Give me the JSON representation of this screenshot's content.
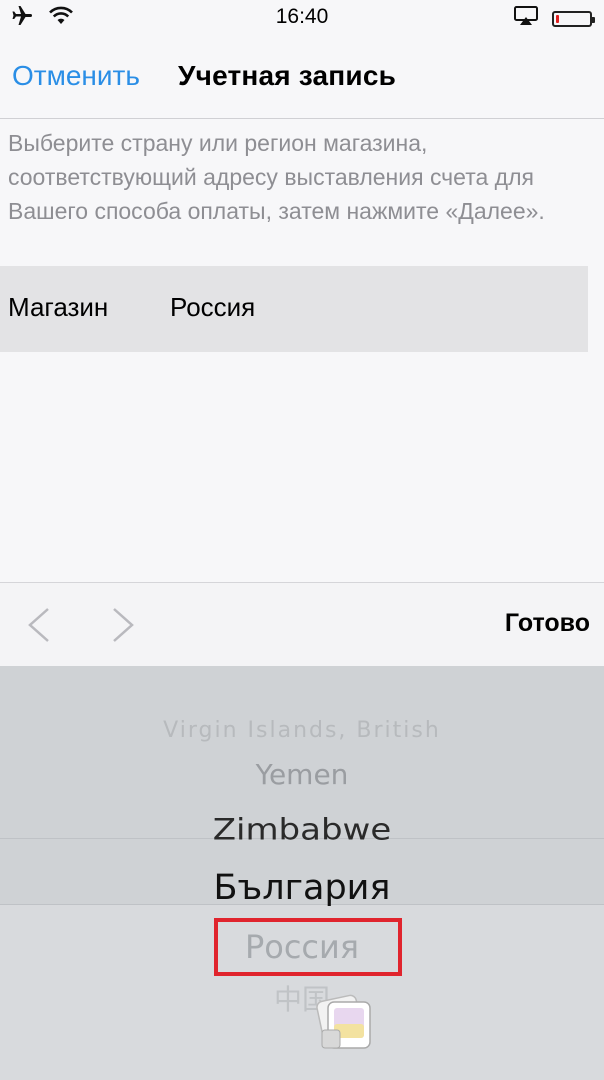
{
  "status_bar": {
    "time": "16:40",
    "icons": [
      "airplane-icon",
      "wifi-icon",
      "airplay-icon",
      "battery-icon"
    ],
    "battery_level": 0.08,
    "battery_color": "#e02020"
  },
  "nav": {
    "cancel": "Отменить",
    "title": "Учетная запись",
    "accent_color": "#2a8ee6"
  },
  "instruction": "Выберите страну или регион магазина, соответствующий адресу выставления счета для Вашего способа оплаты, затем нажмите «Далее».",
  "store_row": {
    "label": "Магазин",
    "value": "Россия"
  },
  "toolbar": {
    "prev_icon": "chevron-left-icon",
    "next_icon": "chevron-right-icon",
    "done": "Готово"
  },
  "picker": {
    "items": [
      "Virgin Islands, British",
      "Yemen",
      "Zimbabwe",
      "България",
      "Россия",
      "中国"
    ],
    "selected": "Россия",
    "highlight_color": "#e0242d"
  }
}
